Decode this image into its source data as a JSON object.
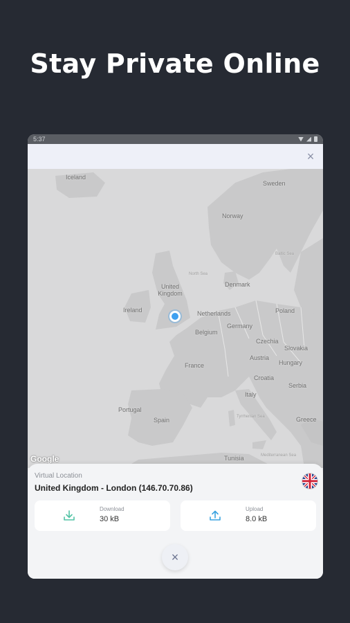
{
  "headline": "Stay Private Online",
  "status_bar": {
    "time": "5:37",
    "notification_glyph": "G"
  },
  "top_bar": {
    "close_glyph": "×"
  },
  "map": {
    "labels": {
      "iceland": "Iceland",
      "sweden": "Sweden",
      "norway": "Norway",
      "north_sea": "North Sea",
      "denmark": "Denmark",
      "united_kingdom": "United Kingdom",
      "ireland": "Ireland",
      "netherlands": "Netherlands",
      "poland": "Poland",
      "germany": "Germany",
      "belgium": "Belgium",
      "czechia": "Czechia",
      "slovakia": "Slovakia",
      "france": "France",
      "austria": "Austria",
      "hungary": "Hungary",
      "croatia": "Croatia",
      "serbia": "Serbia",
      "italy": "Italy",
      "portugal": "Portugal",
      "spain": "Spain",
      "greece": "Greece",
      "tunisia": "Tunisia",
      "baltic_sea": "Baltic Sea",
      "tyrrhenian_sea": "Tyrrhenian Sea",
      "mediterranean_sea": "Mediterranean Sea"
    },
    "attribution": "Google"
  },
  "connection": {
    "caption": "Virtual Location",
    "location": "United Kingdom - London (146.70.70.86)",
    "download_label": "Download",
    "download_value": "30 kB",
    "upload_label": "Upload",
    "upload_value": "8.0 kB",
    "close_glyph": "×"
  },
  "colors": {
    "background": "#262a33",
    "accent_pin": "#3ea0f0",
    "download_icon": "#52c3a5",
    "upload_icon": "#3aa3e0"
  },
  "icons": {
    "flag": "united-kingdom-flag",
    "download": "download-icon",
    "upload": "upload-icon"
  }
}
